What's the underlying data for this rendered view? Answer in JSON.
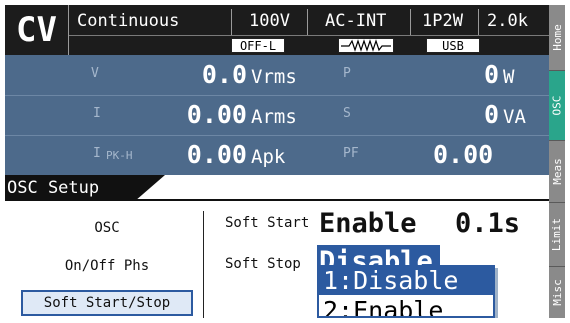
{
  "status": {
    "mode": "CV",
    "continuous": "Continuous",
    "voltage_range": "100V",
    "source": "AC-INT",
    "wiring": "1P2W",
    "range_k": "2.0k",
    "output_state": "OFF-L",
    "waveform_icon": "sine-wave-icon",
    "interface": "USB"
  },
  "measurements": {
    "rows": [
      {
        "left_label": "V",
        "left_sub": "",
        "left_value": "0.0",
        "left_unit": "Vrms",
        "right_label": "P",
        "right_value": "0",
        "right_unit": "W"
      },
      {
        "left_label": "I",
        "left_sub": "",
        "left_value": "0.00",
        "left_unit": "Arms",
        "right_label": "S",
        "right_value": "0",
        "right_unit": "VA"
      },
      {
        "left_label": "I",
        "left_sub": "PK-H",
        "left_value": "0.00",
        "left_unit": "Apk",
        "right_label": "PF",
        "right_value": "0.00",
        "right_unit": ""
      }
    ]
  },
  "tabs": [
    {
      "label": "Home",
      "active": false
    },
    {
      "label": "OSC",
      "active": true
    },
    {
      "label": "Meas",
      "active": false
    },
    {
      "label": "Limit",
      "active": false
    },
    {
      "label": "Misc",
      "active": false
    }
  ],
  "setup": {
    "title": "OSC Setup",
    "menu": [
      "OSC",
      "On/Off Phs",
      "Soft Start/Stop"
    ],
    "soft_start_label": "Soft Start",
    "soft_start_value": "Enable",
    "soft_start_time": "0.1s",
    "soft_stop_label": "Soft Stop",
    "soft_stop_value": "Disable",
    "dropdown_options": [
      "1:Disable",
      "2:Enable"
    ]
  },
  "colors": {
    "measure_bg": "#4d6a8b",
    "accent_blue": "#2c5aa0",
    "active_tab": "#2aa58b",
    "status_bg": "#1c1c1c"
  }
}
